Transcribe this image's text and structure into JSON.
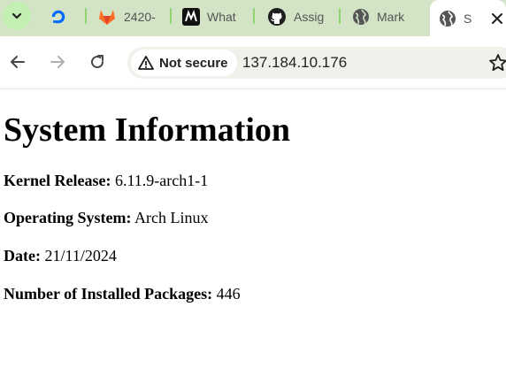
{
  "browser": {
    "tabs": [
      {
        "label": "",
        "icon": "digitalocean-icon"
      },
      {
        "label": "2420-",
        "icon": "gitlab-icon"
      },
      {
        "label": "What",
        "icon": "medium-icon"
      },
      {
        "label": "Assig",
        "icon": "github-icon"
      },
      {
        "label": "Mark",
        "icon": "globe-icon"
      },
      {
        "label": "S",
        "icon": "globe-icon",
        "active": true
      }
    ],
    "security_chip": "Not secure",
    "url": "137.184.10.176"
  },
  "page": {
    "title": "System Information",
    "fields": [
      {
        "label": "Kernel Release:",
        "value": "6.11.9-arch1-1"
      },
      {
        "label": "Operating System:",
        "value": "Arch Linux"
      },
      {
        "label": "Date:",
        "value": "21/11/2024"
      },
      {
        "label": "Number of Installed Packages:",
        "value": "446"
      }
    ]
  },
  "colors": {
    "tabstrip_bg": "#d3e3c6",
    "tab_separator": "#8fd46f",
    "omnibox_bg": "#eef2ea"
  }
}
